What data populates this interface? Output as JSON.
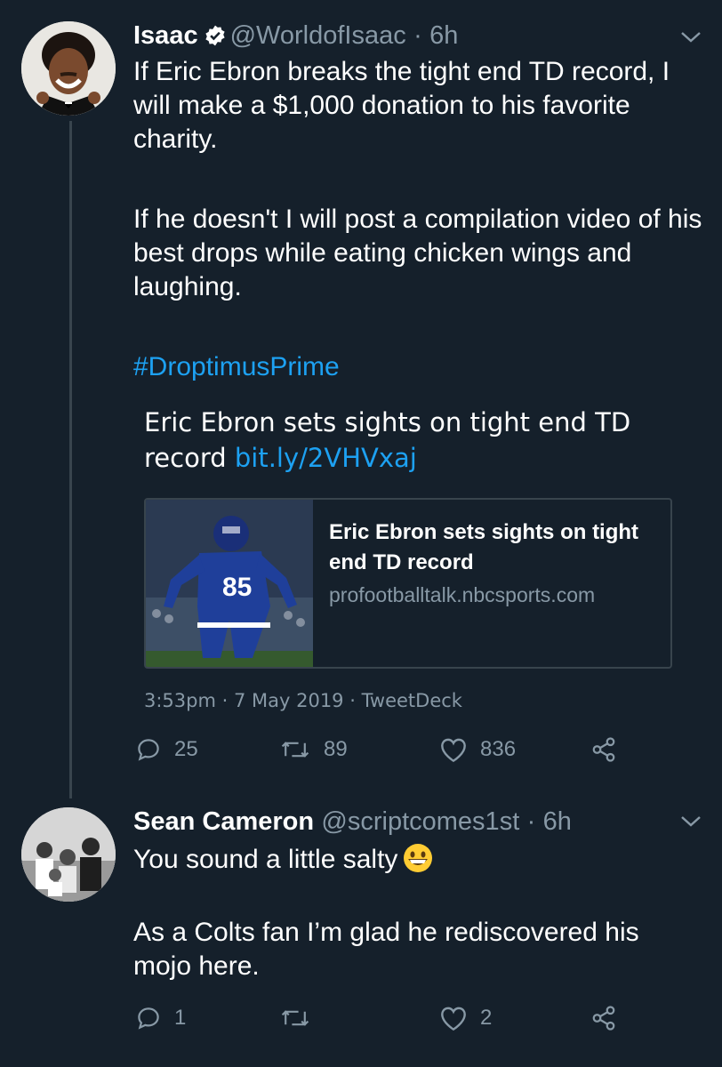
{
  "tweets": [
    {
      "name": "Isaac",
      "handle": "@WorldofIsaac",
      "separator": "·",
      "time": "6h",
      "paragraphs": [
        "If Eric Ebron breaks the tight end TD record, I will make a $1,000 donation to his favorite charity.",
        "If he doesn't I will post a compilation video of his best drops while eating chicken wings and laughing."
      ],
      "hashtag": "#DroptimusPrime",
      "quoted": {
        "headline": "Eric Ebron sets sights on tight end TD record",
        "link": "bit.ly/2VHVxaj",
        "card_title": "Eric Ebron sets sights on tight end TD record",
        "card_domain": "profootballtalk.nbcsports.com",
        "meta": "3:53pm · 7 May 2019 · TweetDeck"
      },
      "stats": {
        "replies": "25",
        "retweets": "89",
        "likes": "836"
      }
    },
    {
      "name": "Sean Cameron",
      "handle": "@scriptcomes1st",
      "separator": "·",
      "time": "6h",
      "paragraphs": [
        "You sound a little salty",
        "As a Colts fan I’m glad he rediscovered his mojo here."
      ],
      "stats": {
        "replies": "1",
        "retweets": "",
        "likes": "2"
      }
    }
  ],
  "icons": [
    "verified-badge-icon",
    "chevron-down-icon",
    "reply-icon",
    "retweet-icon",
    "like-icon",
    "share-icon",
    "grinning-emoji-icon"
  ],
  "colors": {
    "background": "#15202b",
    "link": "#1da1f2",
    "muted": "#8899a6",
    "border": "#38444d"
  }
}
